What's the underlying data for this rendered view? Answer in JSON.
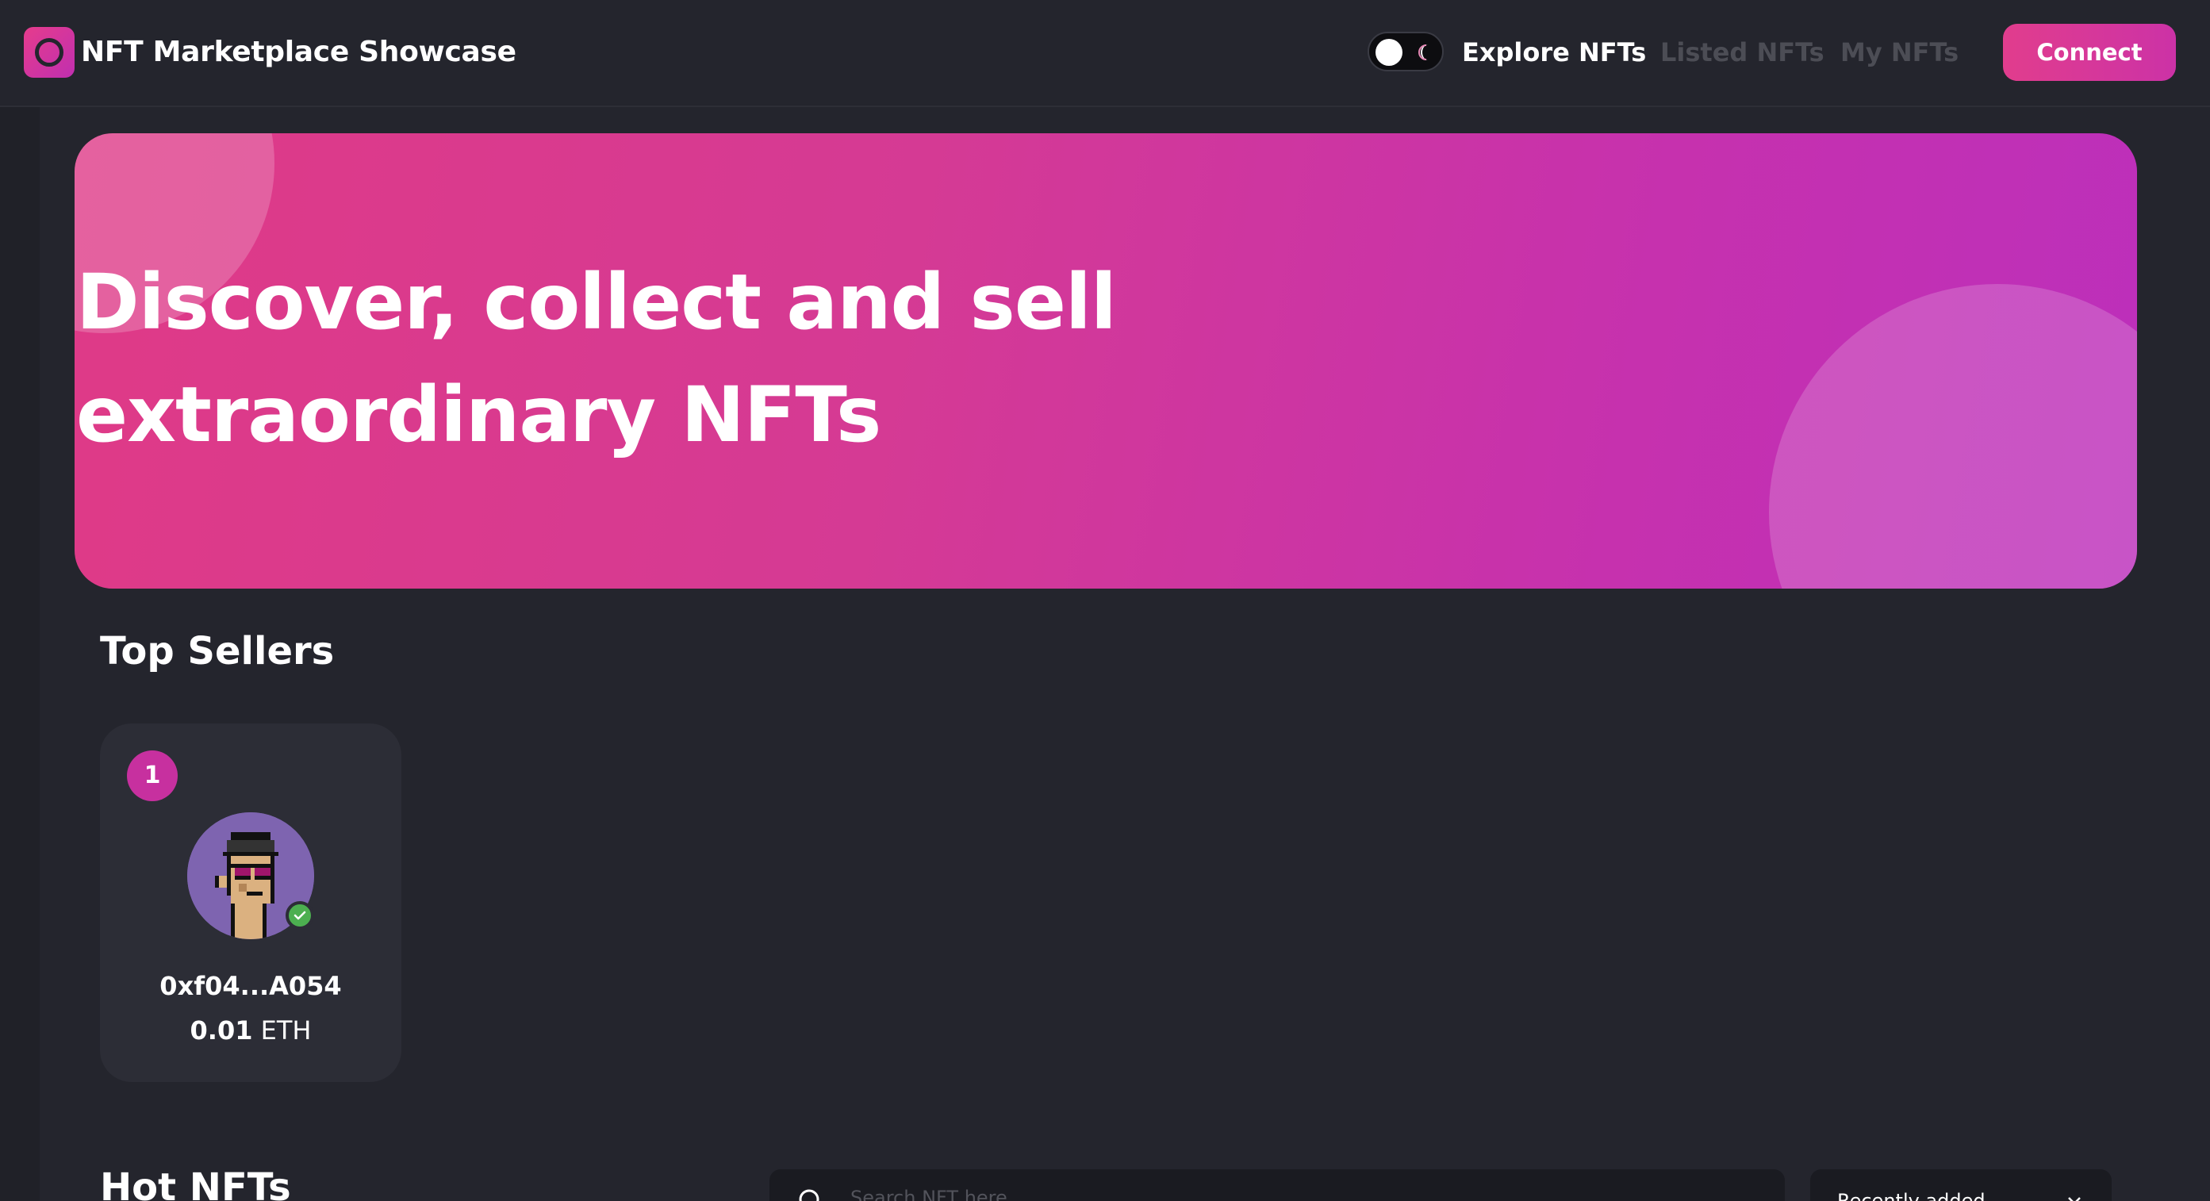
{
  "app": {
    "title": "NFT Marketplace Showcase"
  },
  "navbar": {
    "links": [
      {
        "label": "Explore NFTs",
        "active": true
      },
      {
        "label": "Listed NFTs",
        "active": false
      },
      {
        "label": "My NFTs",
        "active": false
      }
    ],
    "connect_label": "Connect",
    "theme_toggle": {
      "state": "dark",
      "icon": "moon-icon"
    }
  },
  "hero": {
    "title_line1": "Discover, collect and sell",
    "title_line2": "extraordinary NFTs"
  },
  "top_sellers": {
    "title": "Top Sellers",
    "sellers": [
      {
        "rank": "1",
        "address": "0xf04...A054",
        "amount": "0.01",
        "currency": "ETH",
        "verified": true
      }
    ]
  },
  "hot_nfts": {
    "title": "Hot NFTs",
    "search_placeholder": "Search NFT here",
    "sort_selected": "Recently added"
  },
  "colors": {
    "background": "#24252d",
    "accent": "#e13d8d",
    "accent_secondary": "#c02fb0",
    "card": "#2c2d36",
    "muted_link": "#4c4d55",
    "verified": "#4caf50"
  }
}
